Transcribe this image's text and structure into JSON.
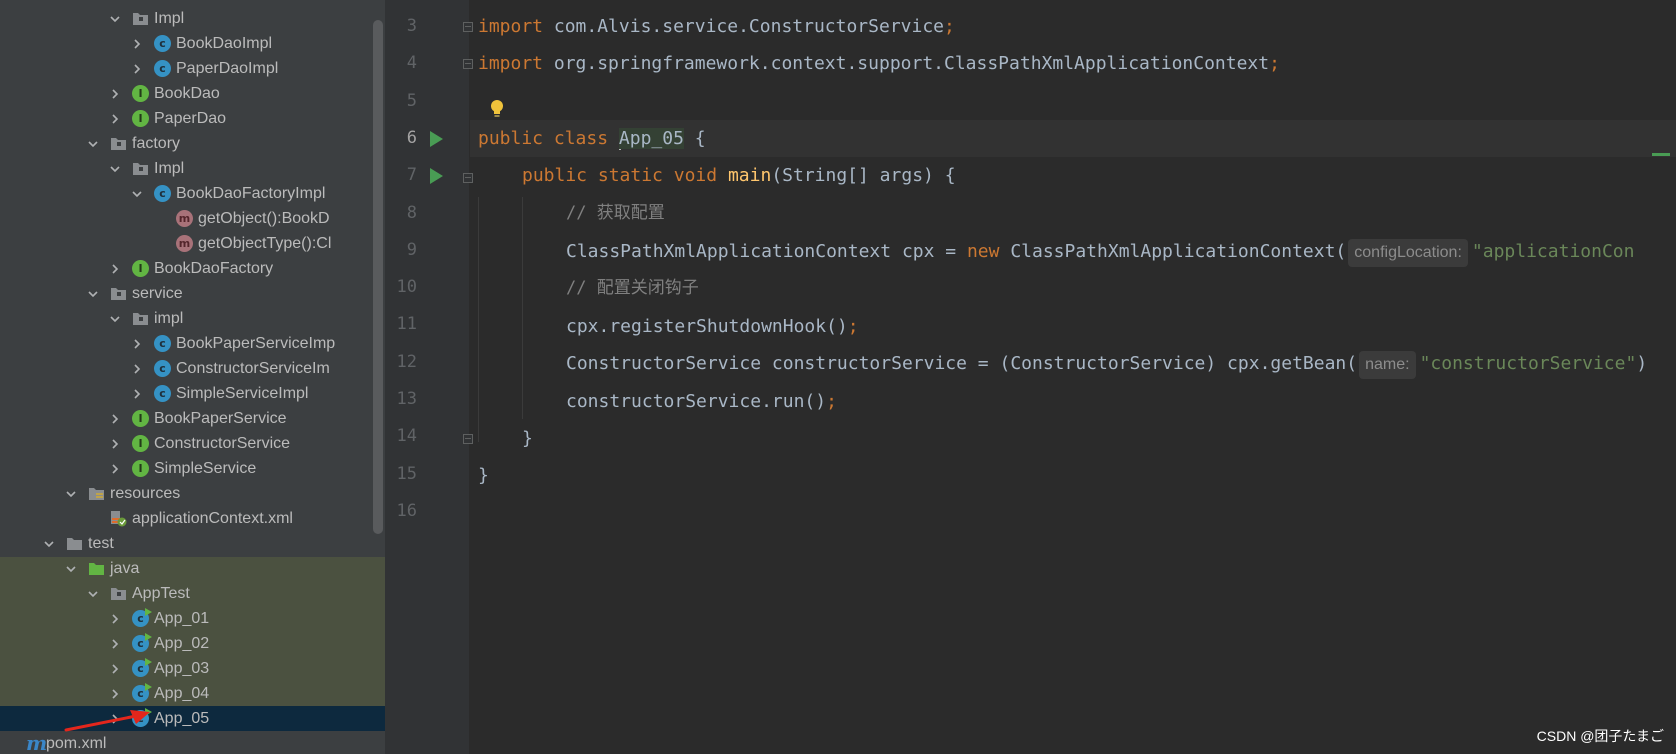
{
  "tree": {
    "items": [
      {
        "label": "Impl",
        "kind": "package",
        "arrow": "down",
        "level": 4
      },
      {
        "label": "BookDaoImpl",
        "kind": "class",
        "arrow": "right",
        "level": 5
      },
      {
        "label": "PaperDaoImpl",
        "kind": "class",
        "arrow": "right",
        "level": 5
      },
      {
        "label": "BookDao",
        "kind": "interface",
        "arrow": "right",
        "level": 4
      },
      {
        "label": "PaperDao",
        "kind": "interface",
        "arrow": "right",
        "level": 4
      },
      {
        "label": "factory",
        "kind": "package",
        "arrow": "down",
        "level": 3
      },
      {
        "label": "Impl",
        "kind": "package",
        "arrow": "down",
        "level": 4
      },
      {
        "label": "BookDaoFactoryImpl",
        "kind": "class",
        "arrow": "down",
        "level": 5
      },
      {
        "label": "getObject():BookD",
        "kind": "method",
        "arrow": "none",
        "level": 6
      },
      {
        "label": "getObjectType():Cl",
        "kind": "method",
        "arrow": "none",
        "level": 6
      },
      {
        "label": "BookDaoFactory",
        "kind": "interface",
        "arrow": "right",
        "level": 4
      },
      {
        "label": "service",
        "kind": "package",
        "arrow": "down",
        "level": 3
      },
      {
        "label": "impl",
        "kind": "package",
        "arrow": "down",
        "level": 4
      },
      {
        "label": "BookPaperServiceImp",
        "kind": "class",
        "arrow": "right",
        "level": 5
      },
      {
        "label": "ConstructorServiceIm",
        "kind": "class",
        "arrow": "right",
        "level": 5
      },
      {
        "label": "SimpleServiceImpl",
        "kind": "class",
        "arrow": "right",
        "level": 5
      },
      {
        "label": "BookPaperService",
        "kind": "interface",
        "arrow": "right",
        "level": 4
      },
      {
        "label": "ConstructorService",
        "kind": "interface",
        "arrow": "right",
        "level": 4
      },
      {
        "label": "SimpleService",
        "kind": "interface",
        "arrow": "right",
        "level": 4
      },
      {
        "label": "resources",
        "kind": "resources",
        "arrow": "down",
        "level": 2
      },
      {
        "label": "applicationContext.xml",
        "kind": "xml",
        "arrow": "none",
        "level": 3
      },
      {
        "label": "test",
        "kind": "folder",
        "arrow": "down",
        "level": 1
      },
      {
        "label": "java",
        "kind": "testsrc",
        "arrow": "down",
        "level": 2
      },
      {
        "label": "AppTest",
        "kind": "package",
        "arrow": "down",
        "level": 3
      },
      {
        "label": "App_01",
        "kind": "runclass",
        "arrow": "right",
        "level": 4
      },
      {
        "label": "App_02",
        "kind": "runclass",
        "arrow": "right",
        "level": 4
      },
      {
        "label": "App_03",
        "kind": "runclass",
        "arrow": "right",
        "level": 4
      },
      {
        "label": "App_04",
        "kind": "runclass",
        "arrow": "right",
        "level": 4
      },
      {
        "label": "App_05",
        "kind": "runclass",
        "arrow": "right",
        "level": 4,
        "selected": true
      },
      {
        "label": "pom.xml",
        "kind": "maven",
        "arrow": "none",
        "level": 0
      }
    ]
  },
  "editor": {
    "line_numbers": [
      "3",
      "4",
      "5",
      "6",
      "7",
      "8",
      "9",
      "10",
      "11",
      "12",
      "13",
      "14",
      "15",
      "16"
    ],
    "current_line": "6",
    "lines": {
      "l3": {
        "import_kw": "import",
        "rest": " com.Alvis.service.ConstructorService",
        "semi": ";"
      },
      "l4": {
        "import_kw": "import",
        "rest": " org.springframework.context.support.ClassPathXmlApplicationContext",
        "semi": ";"
      },
      "l6": {
        "kw1": "public",
        "kw2": "class",
        "name": "App_05",
        "rest": " {"
      },
      "l7": {
        "kw1": "public",
        "kw2": "static",
        "kw3": "void",
        "fn": "main",
        "rest": "(String[] args) {"
      },
      "l8": {
        "comment": "// 获取配置"
      },
      "l9": {
        "a": "ClassPathXmlApplicationContext cpx = ",
        "kw": "new",
        "b": " ClassPathXmlApplicationContext(",
        "hint": "configLocation:",
        "str": "\"applicationCon"
      },
      "l10": {
        "comment": "// 配置关闭钩子"
      },
      "l11": {
        "a": "cpx.registerShutdownHook()",
        "semi": ";"
      },
      "l12": {
        "a": "ConstructorService constructorService = (ConstructorService) cpx.getBean(",
        "hint": "name:",
        "str": "\"constructorService\"",
        "b": ")"
      },
      "l13": {
        "a": "constructorService.run()",
        "semi": ";"
      },
      "l14": {
        "a": "}"
      },
      "l15": {
        "a": "}"
      }
    }
  },
  "watermark": "CSDN @团子たまご",
  "colors": {
    "keyword": "#cc7832",
    "function": "#ffc66d",
    "comment": "#808080",
    "string": "#6a8759",
    "text": "#a9b7c6",
    "selection": "#0d293e"
  }
}
